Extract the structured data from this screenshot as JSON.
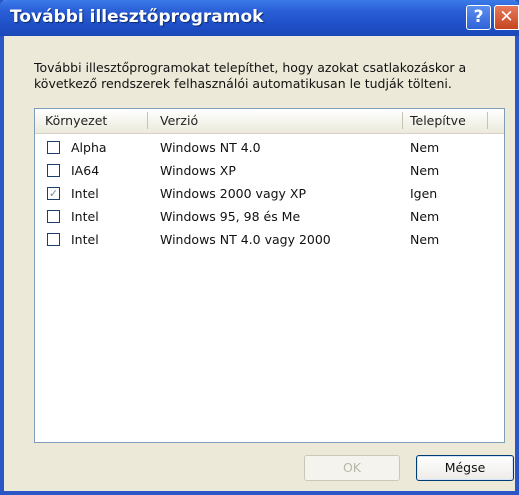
{
  "window": {
    "title": "További illesztőprogramok",
    "help_symbol": "?",
    "close_symbol": "✕"
  },
  "intro_text": "További illesztőprogramokat telepíthet, hogy azokat csatlakozáskor a következő rendszerek felhasználói automatikusan le tudják tölteni.",
  "table": {
    "headers": [
      "Környezet",
      "Verzió",
      "Telepítve"
    ],
    "rows": [
      {
        "checked": false,
        "env": "Alpha",
        "version": "Windows NT 4.0",
        "installed": "Nem"
      },
      {
        "checked": false,
        "env": "IA64",
        "version": "Windows XP",
        "installed": "Nem"
      },
      {
        "checked": true,
        "env": "Intel",
        "version": "Windows 2000 vagy XP",
        "installed": "Igen"
      },
      {
        "checked": false,
        "env": "Intel",
        "version": "Windows 95, 98 és Me",
        "installed": "Nem"
      },
      {
        "checked": false,
        "env": "Intel",
        "version": "Windows NT 4.0 vagy 2000",
        "installed": "Nem"
      }
    ]
  },
  "buttons": {
    "ok_label": "OK",
    "cancel_label": "Mégse"
  },
  "check_glyph": "✓"
}
